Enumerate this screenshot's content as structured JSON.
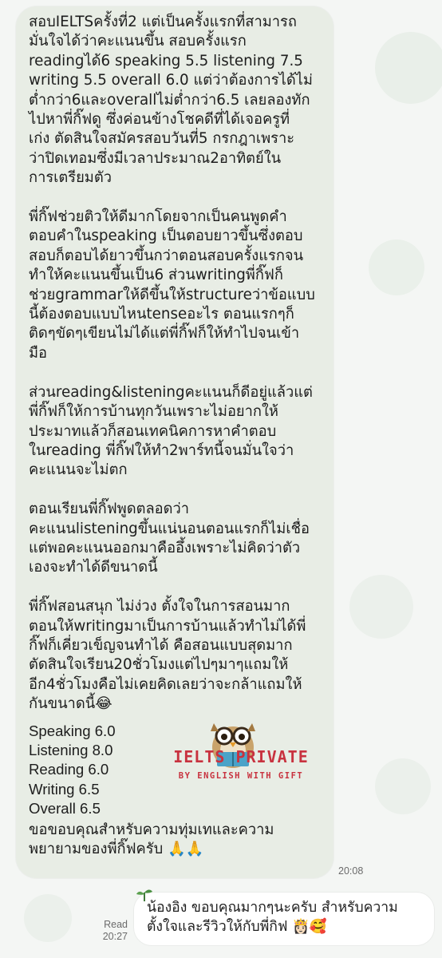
{
  "chat": {
    "incoming": {
      "paragraphs": [
        "สอบIELTSครั้งที่2 แต่เป็นครั้งแรกที่สามารถ\nมั่นใจได้ว่าคะแนนขึ้น สอบครั้งแรก\nreadingได้6 speaking 5.5 listening 7.5\nwriting 5.5 overall 6.0 แต่ว่าต้องการได้ไม่\nต่ำกว่า6และoverallไม่ต่ำกว่า6.5 เลยลองทัก\nไปหาพี่กิ๊ฟดู ซึ่งค่อนข้างโชคดีที่ได้เจอครูที่\nเก่ง ตัดสินใจสมัครสอบวันที่5 กรกฎาเพราะ\nว่าปิดเทอมซึ่งมีเวลาประมาณ2อาทิตย์ใน\nการเตรียมตัว",
        "พี่กิ๊ฟช่วยติวให้ดีมากโดยจากเป็นคนพูดคำ\nตอบคำในspeaking เป็นตอบยาวขึ้นซึ่งตอบ\nสอบก็ตอบได้ยาวขึ้นกว่าตอนสอบครั้งแรกจน\nทำให้คะแนนขึ้นเป็น6 ส่วนwritingพี่กิ๊ฟก็\nช่วยgrammarให้ดีขึ้นให้structureว่าข้อแบบ\nนี้ต้องตอบแบบไหนtenseอะไร ตอนแรกๆก็\nติดๆขัดๆเขียนไม่ได้แต่พี่กิ๊ฟก็ให้ทำไปจนเข้า\nมือ",
        "ส่วนreading&listeningคะแนนก็ดีอยู่แล้วแต่\nพี่กิ๊ฟก็ให้การบ้านทุกวันเพราะไม่อยากให้\nประมาทแล้วก็สอนเทคนิคการหาคำตอบ\nในreading พี่กิ๊ฟให้ทำ2พาร์ทนี้จนมั่นใจว่า\nคะแนนจะไม่ตก",
        "ตอนเรียนพี่กิ๊ฟพูดตลอดว่า\nคะแนนlisteningขึ้นแน่นอนตอนแรกก็ไม่เชื่อ\nแต่พอคะแนนออกมาคืออึ้งเพราะไม่คิดว่าตัว\nเองจะทำได้ดีขนาดนี้",
        "พี่กิ๊ฟสอนสนุก ไม่ง่วง ตั้งใจในการสอนมาก\nตอนให้writingมาเป็นการบ้านแล้วทำไม่ได้พี่\nกิ๊ฟก็เคี่ยวเข็ญจนทำได้ คือสอนแบบสุดมาก\nตัดสินใจเรียน20ชั่วโมงแต่ไปๆมาๆแถมให้\nอีก4ชั่วโมงคือไม่เคยคิดเลยว่าจะกล้าแถมให้\nกันขนาดนี้😂"
      ],
      "scores": "Speaking 6.0\nListening 8.0\nReading 6.0\nWriting 6.5\nOverall 6.5",
      "closing": "ขอขอบคุณสำหรับความทุ่มเทและความ\nพยายามของพี่กิ๊ฟครับ 🙏🙏",
      "time": "20:08"
    },
    "watermark": {
      "title": "IELTS PRIVATE",
      "subtitle": "BY ENGLISH WITH GIFT",
      "color": "#c8323f"
    },
    "outgoing": {
      "text": "น้องอิง ขอบคุณมากๆนะครับ สำหรับความ\nตั้งใจและรีวิวให้กับพี่กิฟ 👸🏻🥰",
      "read_label": "Read",
      "time": "20:27"
    }
  },
  "colors": {
    "incoming_bubble": "#e8ede5",
    "outgoing_bubble": "#ffffff",
    "background": "#f4f6f4"
  }
}
